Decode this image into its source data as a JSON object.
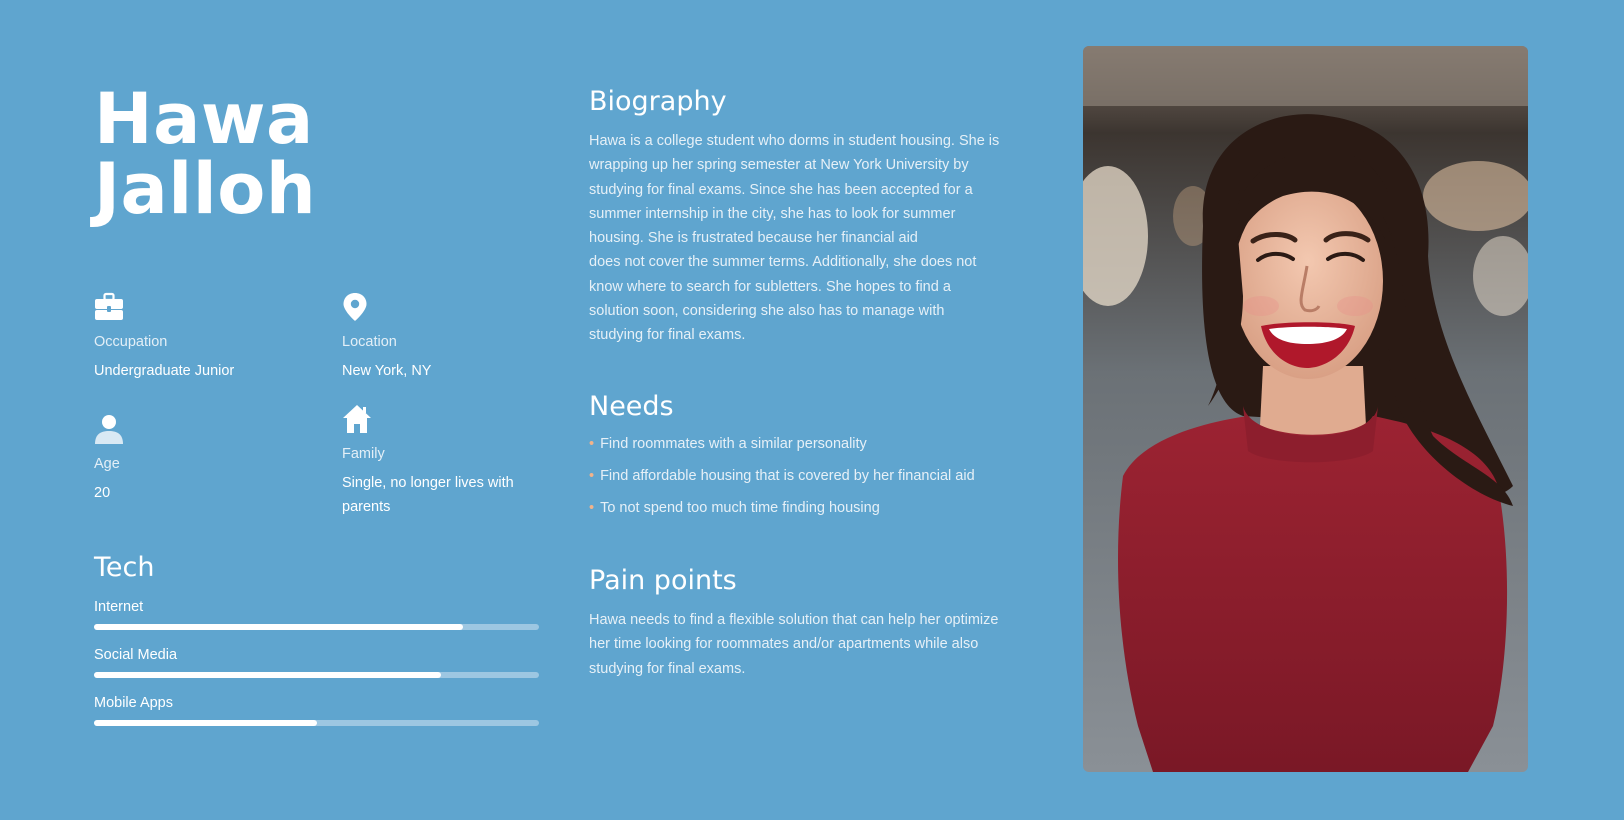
{
  "persona": {
    "first_name": "Hawa",
    "last_name": "Jalloh"
  },
  "details": {
    "occupation": {
      "label": "Occupation",
      "value": "Undergraduate Junior",
      "icon": "briefcase-icon"
    },
    "location": {
      "label": "Location",
      "value": "New York, NY",
      "icon": "map-pin-icon"
    },
    "age": {
      "label": "Age",
      "value": "20",
      "icon": "person-icon"
    },
    "family": {
      "label": "Family",
      "value_line1": "Single, no longer lives with",
      "value_line2": "parents",
      "icon": "home-icon"
    }
  },
  "tech": {
    "title": "Tech",
    "items": [
      {
        "label": "Internet",
        "level": 0.83
      },
      {
        "label": "Social Media",
        "level": 0.78
      },
      {
        "label": "Mobile Apps",
        "level": 0.5
      }
    ]
  },
  "biography": {
    "title": "Biography",
    "lines": [
      "Hawa is a college student who dorms in student housing. She is",
      "wrapping up her spring semester at New York University by",
      "studying for final exams. Since she has been accepted for a",
      "summer internship in the city, she has to look for summer",
      "housing. She is frustrated because her financial aid",
      "does not cover the summer terms. Additionally, she does not",
      "know where to search for subletters. She hopes to find a",
      "solution soon, considering she also has to manage with",
      "studying for final exams."
    ]
  },
  "needs": {
    "title": "Needs",
    "items": [
      "Find roommates with a similar personality",
      "Find affordable housing that is covered by her financial aid",
      "To not spend too much time finding housing"
    ]
  },
  "pain_points": {
    "title": "Pain points",
    "lines": [
      "Hawa needs to find a flexible solution that can help her optimize",
      "her time looking for roommates and/or apartments while also",
      "studying for final exams."
    ]
  },
  "colors": {
    "background": "#5fa5cf",
    "bullet": "#f2b38a",
    "sweater": "#8c1f2c"
  }
}
